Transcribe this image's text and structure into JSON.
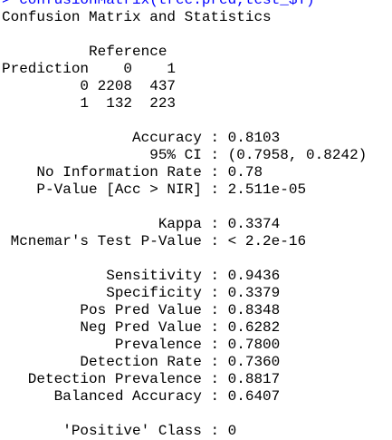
{
  "console": {
    "command": "> confusionMatrix(tree.pred,test_$Y)",
    "title": "Confusion Matrix and Statistics",
    "matrix": {
      "reference_header": "          Reference",
      "column_header": "Prediction    0    1",
      "row_0": "         0 2208  437",
      "row_1": "         1  132  223"
    },
    "stats": {
      "accuracy": "               Accuracy : 0.8103",
      "ci": "                 95% CI : (0.7958, 0.8242)",
      "nir": "    No Information Rate : 0.78",
      "pvalue": "    P-Value [Acc > NIR] : 2.511e-05",
      "kappa": "                  Kappa : 0.3374",
      "mcnemar": " Mcnemar's Test P-Value : < 2.2e-16",
      "sensitivity": "            Sensitivity : 0.9436",
      "specificity": "            Specificity : 0.3379",
      "pos_pred": "         Pos Pred Value : 0.8348",
      "neg_pred": "         Neg Pred Value : 0.6282",
      "prevalence": "             Prevalence : 0.7800",
      "detection_rate": "         Detection Rate : 0.7360",
      "detection_prevalence": "   Detection Prevalence : 0.8817",
      "balanced_accuracy": "      Balanced Accuracy : 0.6407",
      "positive_class": "       'Positive' Class : 0"
    }
  }
}
